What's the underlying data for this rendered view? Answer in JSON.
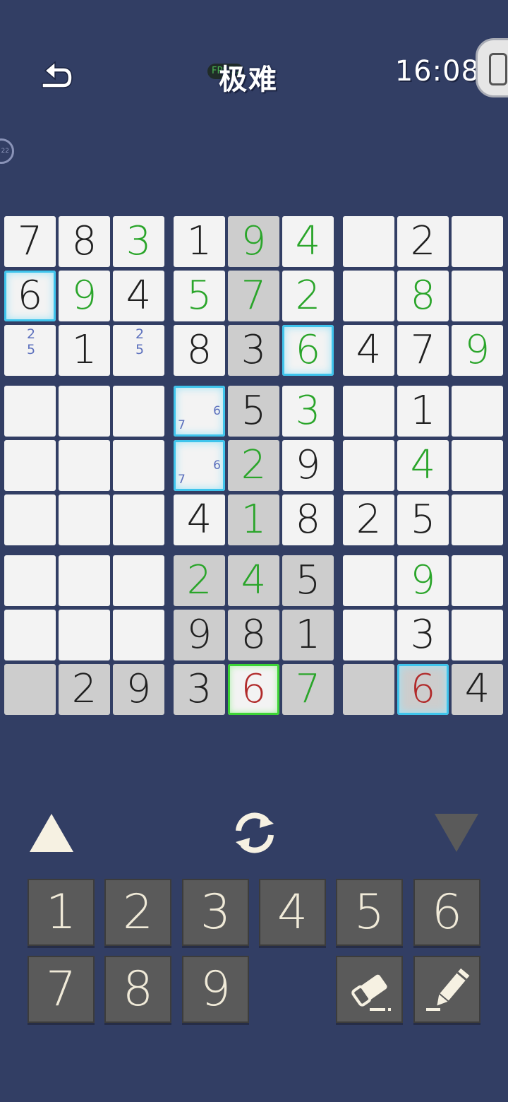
{
  "header": {
    "back_label": "back",
    "fps_badge": "FPS59",
    "title": "极难",
    "clock": "16:08",
    "side_badge": "22"
  },
  "board": {
    "rows": [
      [
        {
          "v": "7",
          "t": "given"
        },
        {
          "v": "8",
          "t": "given"
        },
        {
          "v": "3",
          "t": "user"
        },
        {
          "v": "1",
          "t": "given"
        },
        {
          "v": "9",
          "t": "user",
          "hl": true
        },
        {
          "v": "4",
          "t": "user"
        },
        {
          "v": ""
        },
        {
          "v": "2",
          "t": "given"
        },
        {
          "v": ""
        }
      ],
      [
        {
          "v": "6",
          "t": "given",
          "sel": "blue"
        },
        {
          "v": "9",
          "t": "user"
        },
        {
          "v": "4",
          "t": "given"
        },
        {
          "v": "5",
          "t": "user"
        },
        {
          "v": "7",
          "t": "user",
          "hl": true
        },
        {
          "v": "2",
          "t": "user"
        },
        {
          "v": ""
        },
        {
          "v": "8",
          "t": "user"
        },
        {
          "v": ""
        }
      ],
      [
        {
          "v": "",
          "notes_stack": [
            "2",
            "5"
          ]
        },
        {
          "v": "1",
          "t": "given"
        },
        {
          "v": "",
          "notes_stack": [
            "2",
            "5"
          ]
        },
        {
          "v": "8",
          "t": "given"
        },
        {
          "v": "3",
          "t": "given",
          "hl": true
        },
        {
          "v": "6",
          "t": "user",
          "sel": "blue"
        },
        {
          "v": "4",
          "t": "given"
        },
        {
          "v": "7",
          "t": "given"
        },
        {
          "v": "9",
          "t": "user"
        }
      ],
      [
        {
          "v": ""
        },
        {
          "v": ""
        },
        {
          "v": ""
        },
        {
          "v": "",
          "sel": "blue",
          "notes_corner": [
            "6",
            "7"
          ]
        },
        {
          "v": "5",
          "t": "given",
          "hl": true
        },
        {
          "v": "3",
          "t": "user"
        },
        {
          "v": ""
        },
        {
          "v": "1",
          "t": "given"
        },
        {
          "v": ""
        }
      ],
      [
        {
          "v": ""
        },
        {
          "v": ""
        },
        {
          "v": ""
        },
        {
          "v": "",
          "sel": "blue",
          "notes_corner": [
            "6",
            "7"
          ]
        },
        {
          "v": "2",
          "t": "user",
          "hl": true
        },
        {
          "v": "9",
          "t": "given"
        },
        {
          "v": ""
        },
        {
          "v": "4",
          "t": "user"
        },
        {
          "v": ""
        }
      ],
      [
        {
          "v": ""
        },
        {
          "v": ""
        },
        {
          "v": ""
        },
        {
          "v": "4",
          "t": "given"
        },
        {
          "v": "1",
          "t": "user",
          "hl": true
        },
        {
          "v": "8",
          "t": "given"
        },
        {
          "v": "2",
          "t": "given"
        },
        {
          "v": "5",
          "t": "given"
        },
        {
          "v": ""
        }
      ],
      [
        {
          "v": ""
        },
        {
          "v": ""
        },
        {
          "v": ""
        },
        {
          "v": "2",
          "t": "user",
          "hl": true
        },
        {
          "v": "4",
          "t": "user",
          "hl": true
        },
        {
          "v": "5",
          "t": "given",
          "hl": true
        },
        {
          "v": ""
        },
        {
          "v": "9",
          "t": "user"
        },
        {
          "v": ""
        }
      ],
      [
        {
          "v": ""
        },
        {
          "v": ""
        },
        {
          "v": ""
        },
        {
          "v": "9",
          "t": "given",
          "hl": true
        },
        {
          "v": "8",
          "t": "given",
          "hl": true
        },
        {
          "v": "1",
          "t": "given",
          "hl": true
        },
        {
          "v": ""
        },
        {
          "v": "3",
          "t": "given"
        },
        {
          "v": ""
        }
      ],
      [
        {
          "v": "",
          "hl": true
        },
        {
          "v": "2",
          "t": "given",
          "hl": true
        },
        {
          "v": "9",
          "t": "given",
          "hl": true
        },
        {
          "v": "3",
          "t": "given",
          "hl": true
        },
        {
          "v": "6",
          "t": "error",
          "sel": "green"
        },
        {
          "v": "7",
          "t": "user",
          "hl": true
        },
        {
          "v": "",
          "hl": true
        },
        {
          "v": "6",
          "t": "error",
          "hl": true,
          "sel": "blue"
        },
        {
          "v": "4",
          "t": "given",
          "hl": true
        }
      ]
    ]
  },
  "controls": {
    "up_icon": "triangle-up-icon",
    "refresh_icon": "refresh-icon",
    "down_icon": "triangle-down-icon"
  },
  "keypad": {
    "digits": [
      "1",
      "2",
      "3",
      "4",
      "5",
      "6",
      "7",
      "8",
      "9"
    ],
    "erase_icon": "eraser-icon",
    "pencil_icon": "pencil-icon"
  },
  "colors": {
    "background": "#323e64",
    "cell": "#f3f3f3",
    "highlight": "#cdcdcd",
    "given_digit": "#202020",
    "user_digit": "#2aa52a",
    "error_digit": "#b12a2a",
    "note_digit": "#5c70bd",
    "select_blue": "#3fc4ec",
    "select_green": "#3dd435",
    "key_bg": "#5a5a5a"
  }
}
